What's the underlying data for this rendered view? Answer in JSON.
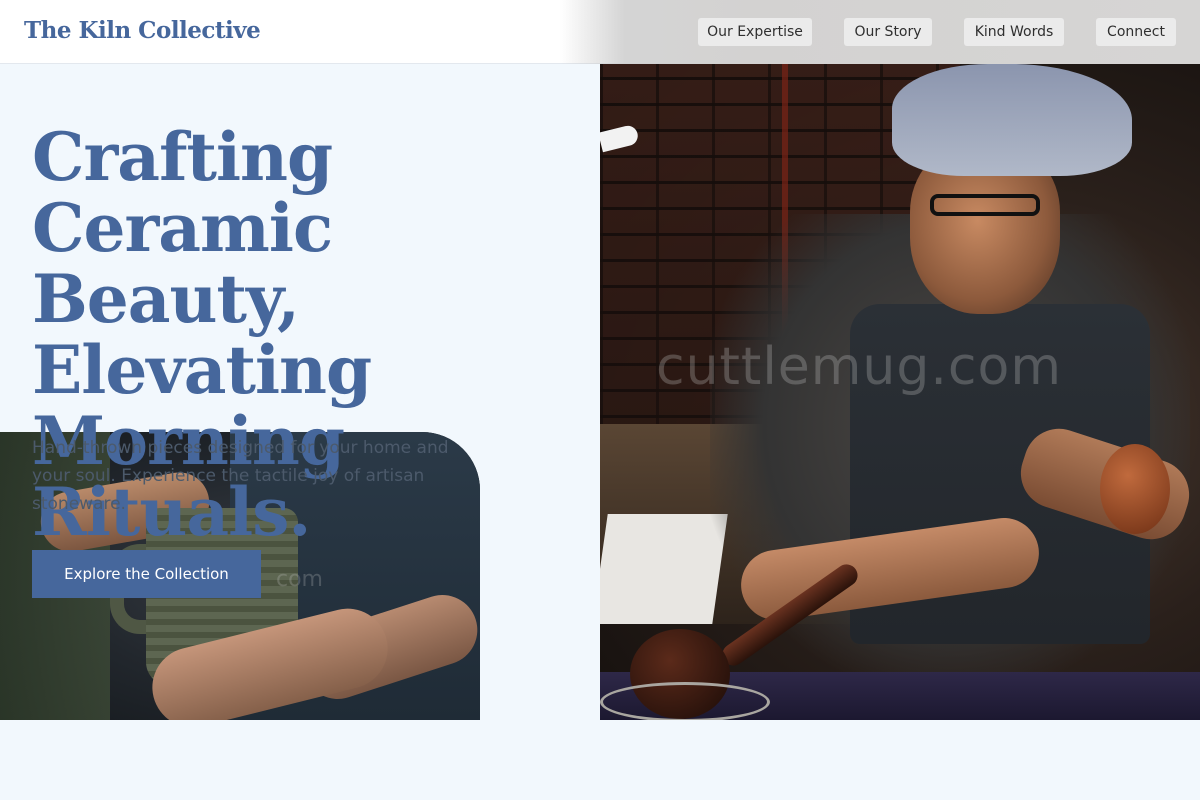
{
  "header": {
    "logo": "The Kiln Collective",
    "nav": [
      "Our Expertise",
      "Our Story",
      "Kind Words",
      "Connect"
    ]
  },
  "hero": {
    "title_lines": [
      "Crafting Ceramic",
      "Beauty,",
      "Elevating",
      "Morning Rituals."
    ],
    "subtitle": "Hand-thrown pieces designed for your home and your soul. Experience the tactile joy of artisan stoneware.",
    "cta": "Explore the Collection"
  },
  "watermark": "cuttlemug.com",
  "watermark_fragment": "com",
  "colors": {
    "brand": "#46679c",
    "background": "#f2f8fd",
    "nav_button": "#ebebeb"
  }
}
